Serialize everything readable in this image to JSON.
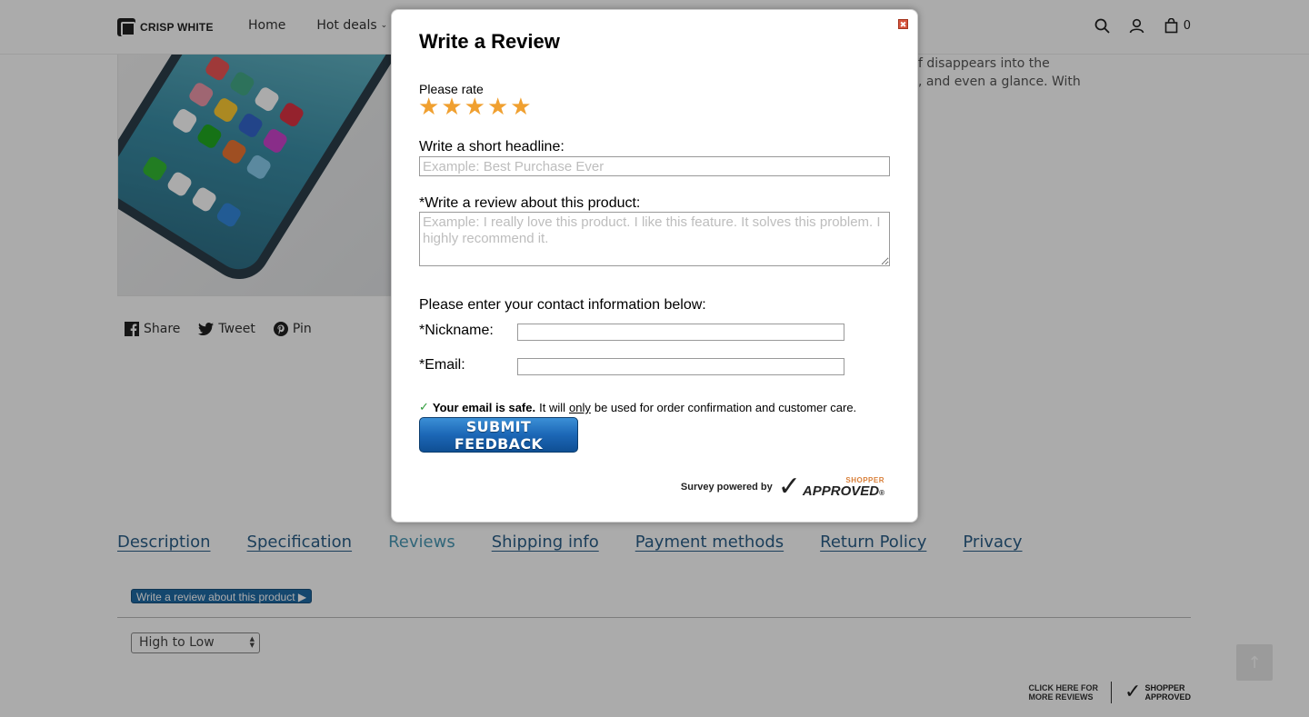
{
  "header": {
    "logo_text": "CRISP WHITE",
    "nav": [
      {
        "label": "Home"
      },
      {
        "label": "Hot deals",
        "icon": "chevron-down-icon"
      }
    ],
    "icons": [
      "search-icon",
      "user-icon",
      "cart-icon"
    ],
    "cart_count": "0"
  },
  "product": {
    "description_line1": "f disappears into the",
    "description_line2": ", and even a glance. With"
  },
  "share": {
    "share_label": "Share",
    "tweet_label": "Tweet",
    "pin_label": "Pin"
  },
  "tabs": [
    {
      "label": "Description"
    },
    {
      "label": "Specification"
    },
    {
      "label": "Reviews",
      "active": true
    },
    {
      "label": "Shipping info"
    },
    {
      "label": "Payment methods"
    },
    {
      "label": "Return Policy"
    },
    {
      "label": "Privacy"
    }
  ],
  "reviews": {
    "write_button": "Write a review about this product ▶",
    "sort_selected": "High to Low",
    "footer_click": "CLICK HERE FOR",
    "footer_more": "MORE REVIEWS",
    "footer_brand_1": "SHOPPER",
    "footer_brand_2": "APPROVED"
  },
  "modal": {
    "title": "Write a Review",
    "rate_label": "Please rate",
    "rating_max": 5,
    "headline_label": "Write a short headline:",
    "headline_placeholder": "Example: Best Purchase Ever",
    "review_label": "*Write a review about this product:",
    "review_placeholder": "Example: I really love this product. I like this feature. It solves this problem. I highly recommend it.",
    "contact_label": "Please enter your contact information below:",
    "nickname_label": "*Nickname:",
    "email_label": "*Email:",
    "safe_bold": "Your email is safe.",
    "safe_text_1": "It will",
    "safe_only": "only",
    "safe_text_2": "be used for order confirmation and customer care.",
    "submit_label": "SUBMIT FEEDBACK",
    "powered_label": "Survey powered by",
    "powered_brand_small": "SHOPPER",
    "powered_brand_big": "APPROVED",
    "powered_brand_mark": "®"
  },
  "colors": {
    "accent": "#1f6aa5",
    "star": "#f0a030",
    "tab_link": "#2b5f88",
    "tab_active": "#4a99b5"
  }
}
